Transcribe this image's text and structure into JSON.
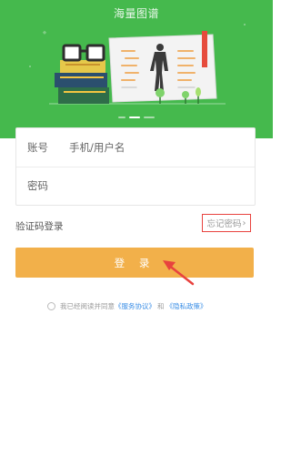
{
  "header": {
    "title": "海量图谱",
    "bg_color": "#45b94d"
  },
  "form": {
    "account_label": "账号",
    "account_placeholder": "手机/用户名",
    "password_label": "密码",
    "password_placeholder": ""
  },
  "sms_login_label": "验证码登录",
  "forgot_password_label": "忘记密码",
  "login_button_label": "登 录",
  "agreement": {
    "prefix": "我已经阅读并同意",
    "terms_link": "《服务协议》",
    "conjunction": "和",
    "privacy_link": "《隐私政策》"
  },
  "colors": {
    "accent_green": "#45b94d",
    "login_button": "#f2b04a",
    "highlight_border": "#e8423e",
    "link": "#3a8ee6"
  },
  "icons": {
    "forgot_chevron": "chevron-right-icon",
    "annotation": "red-arrow-icon"
  }
}
